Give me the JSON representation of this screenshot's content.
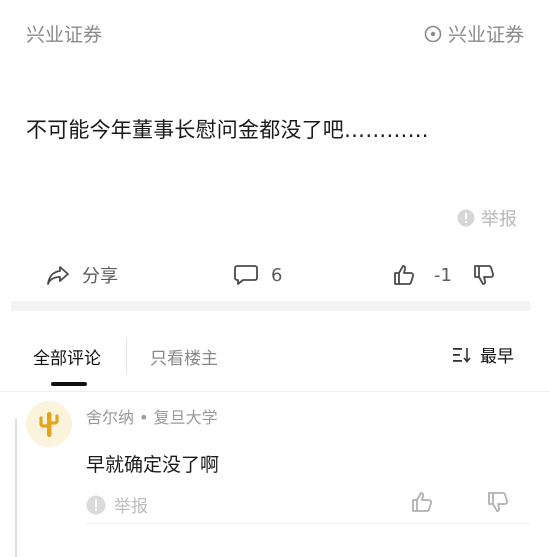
{
  "header": {
    "left_label": "兴业证券",
    "right_label": "兴业证券"
  },
  "post": {
    "text": "不可能今年董事长慰问金都没了吧…………",
    "report_label": "举报"
  },
  "actions": {
    "share_label": "分享",
    "comment_count": "6",
    "like_score": "-1"
  },
  "tabs": {
    "all_comments": "全部评论",
    "op_only": "只看楼主",
    "sort_label": "最早"
  },
  "comments": [
    {
      "meta": "舍尔纳 • 复旦大学",
      "text": "早就确定没了啊",
      "report_label": "举报"
    }
  ],
  "colors": {
    "accent_gold": "#e3a51d",
    "avatar_bg": "#fbf3dc",
    "divider": "#f3f3f3"
  }
}
